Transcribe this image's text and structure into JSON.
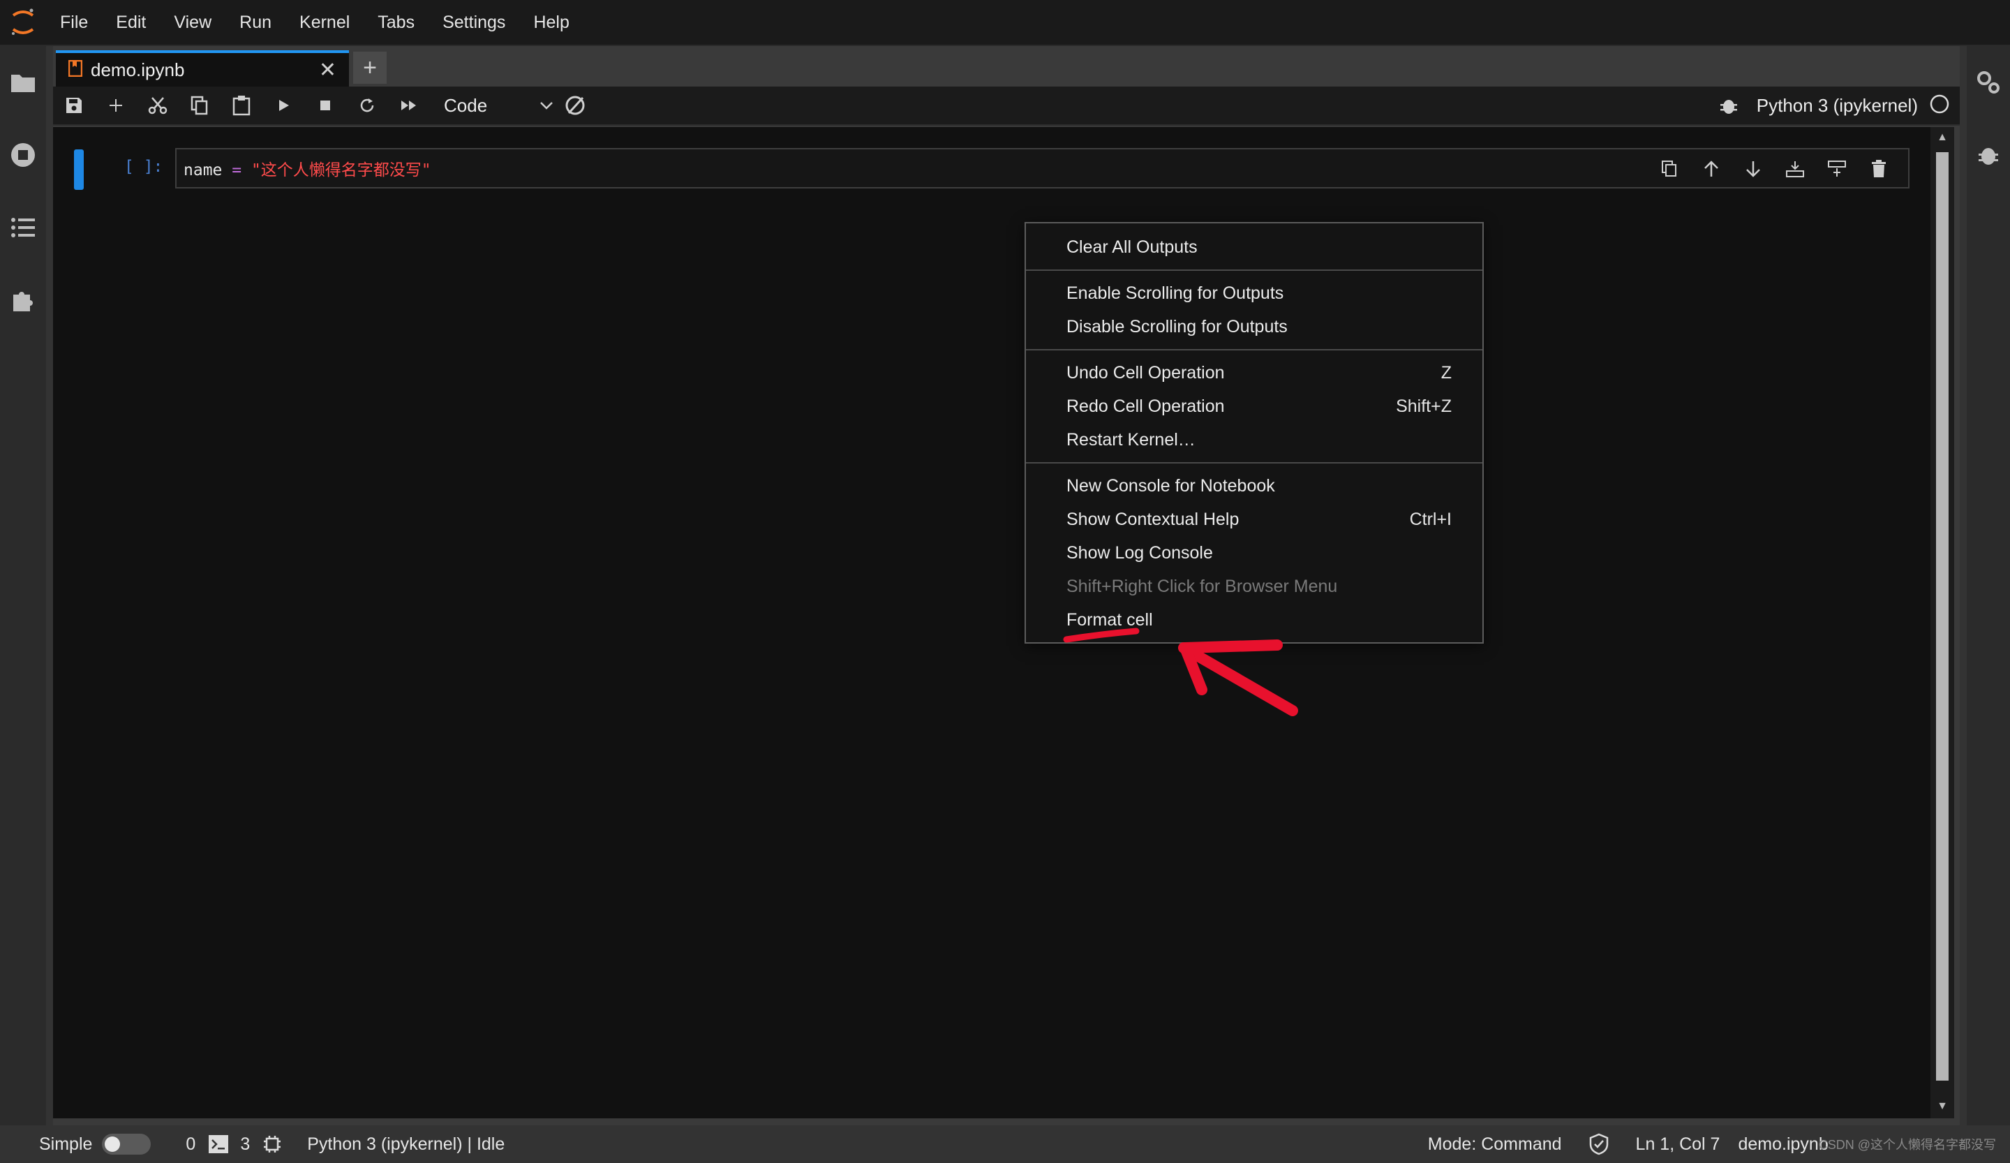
{
  "menubar": {
    "items": [
      "File",
      "Edit",
      "View",
      "Run",
      "Kernel",
      "Tabs",
      "Settings",
      "Help"
    ]
  },
  "tab": {
    "title": "demo.ipynb",
    "close": "✕",
    "add": "+"
  },
  "toolbar": {
    "cell_type": "Code",
    "kernel_name": "Python 3 (ipykernel)"
  },
  "cell": {
    "prompt": "[ ]:",
    "code_var": "name",
    "code_op": " = ",
    "code_str": "\"这个人懒得名字都没写\""
  },
  "context_menu": {
    "items": [
      {
        "label": "Clear All Outputs",
        "shortcut": ""
      },
      {
        "label": "Enable Scrolling for Outputs",
        "shortcut": ""
      },
      {
        "label": "Disable Scrolling for Outputs",
        "shortcut": ""
      },
      {
        "label": "Undo Cell Operation",
        "shortcut": "Z"
      },
      {
        "label": "Redo Cell Operation",
        "shortcut": "Shift+Z"
      },
      {
        "label": "Restart Kernel…",
        "shortcut": ""
      },
      {
        "label": "New Console for Notebook",
        "shortcut": ""
      },
      {
        "label": "Show Contextual Help",
        "shortcut": "Ctrl+I"
      },
      {
        "label": "Show Log Console",
        "shortcut": ""
      },
      {
        "label": "Shift+Right Click for Browser Menu",
        "shortcut": "",
        "disabled": true
      },
      {
        "label": "Format cell",
        "shortcut": ""
      }
    ]
  },
  "statusbar": {
    "mode_label": "Simple",
    "terminals_count": "0",
    "kernels_count": "3",
    "kernel_status": "Python 3 (ipykernel) | Idle",
    "mode": "Mode: Command",
    "cursor": "Ln 1, Col 7",
    "file": "demo.ipynb",
    "watermark": "CSDN @这个人懒得名字都没写"
  },
  "colors": {
    "accent": "#2196f3",
    "annotation": "#e8112d",
    "string": "#ff4b4b",
    "operator": "#c36dde"
  }
}
